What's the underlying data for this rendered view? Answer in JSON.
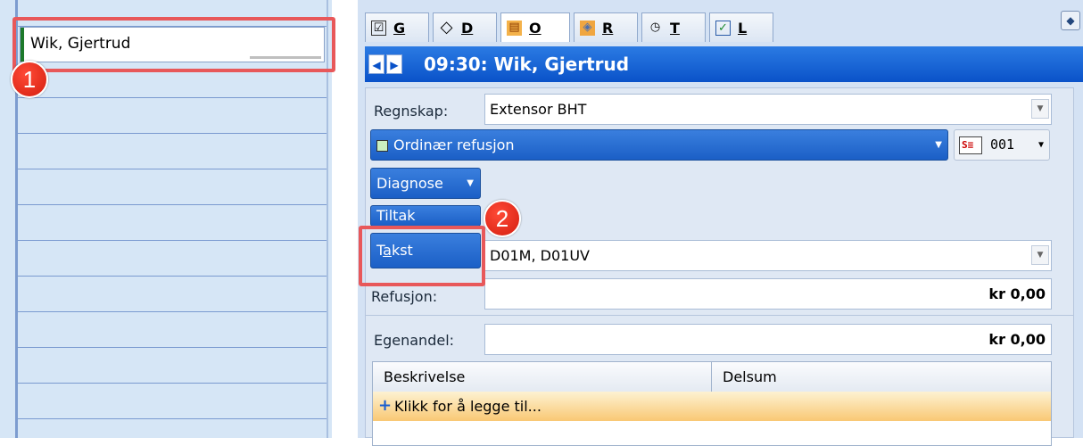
{
  "calendar": {
    "appointment_name": "Wik, Gjertrud"
  },
  "callouts": [
    "1",
    "2"
  ],
  "tabs": [
    {
      "icon": "checkbox-icon",
      "glyph": "☑",
      "label": "G"
    },
    {
      "icon": "diamond-icon",
      "glyph": "◇",
      "label": "D"
    },
    {
      "icon": "pills-icon",
      "glyph": "▤",
      "label": "O"
    },
    {
      "icon": "prescription-icon",
      "glyph": "◈",
      "label": "R"
    },
    {
      "icon": "clock-icon",
      "glyph": "◷",
      "label": "T"
    },
    {
      "icon": "checklist-icon",
      "glyph": "✓",
      "label": "L"
    }
  ],
  "active_tab": "O",
  "header": {
    "title": "09:30: Wik, Gjertrud",
    "prev": "◀",
    "next": "▶"
  },
  "form": {
    "regnskap_label": "Regnskap:",
    "regnskap_value": "Extensor BHT",
    "refusjon_type": "Ordinær refusjon",
    "code_value": "001",
    "code_icon_text": "S≡",
    "diagnose_label": "Diagnose",
    "tiltak_label": "Tiltak",
    "takst_label_pre": "T",
    "takst_label_ul": "a",
    "takst_label_post": "kst",
    "takst_value": "D01M, D01UV",
    "refusjon_label": "Refusjon:",
    "refusjon_value": "kr 0,00",
    "egenandel_label": "Egenandel:",
    "egenandel_value": "kr 0,00"
  },
  "grid": {
    "columns": [
      "Beskrivelse",
      "Delsum"
    ],
    "add_row_text": "Klikk for å legge til..."
  },
  "colors": {
    "header_blue": "#0a52c9",
    "callout_red": "#e8585a",
    "add_row_orange": "#f9c874"
  }
}
